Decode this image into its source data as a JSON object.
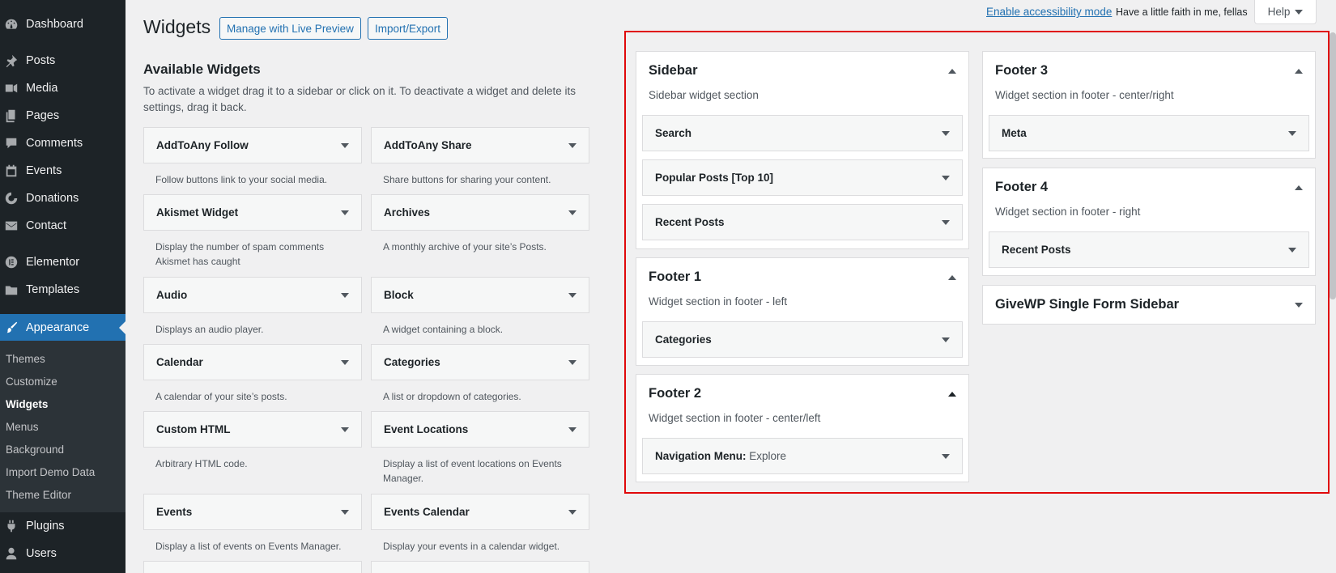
{
  "menu": {
    "dashboard": "Dashboard",
    "posts": "Posts",
    "media": "Media",
    "pages": "Pages",
    "comments": "Comments",
    "events": "Events",
    "donations": "Donations",
    "contact": "Contact",
    "elementor": "Elementor",
    "templates": "Templates",
    "appearance": "Appearance",
    "plugins": "Plugins",
    "users": "Users"
  },
  "submenu": {
    "themes": "Themes",
    "customize": "Customize",
    "widgets": "Widgets",
    "menus": "Menus",
    "background": "Background",
    "import_demo": "Import Demo Data",
    "theme_editor": "Theme Editor"
  },
  "header": {
    "title": "Widgets",
    "live_preview": "Manage with Live Preview",
    "import_export": "Import/Export",
    "accessibility": "Enable accessibility mode",
    "faith": "Have a little faith in me, fellas",
    "help": "Help"
  },
  "available": {
    "title": "Available Widgets",
    "description": "To activate a widget drag it to a sidebar or click on it. To deactivate a widget and delete its settings, drag it back.",
    "widgets": [
      {
        "title": "AddToAny Follow",
        "desc": "Follow buttons link to your social media."
      },
      {
        "title": "AddToAny Share",
        "desc": "Share buttons for sharing your content."
      },
      {
        "title": "Akismet Widget",
        "desc": "Display the number of spam comments Akismet has caught"
      },
      {
        "title": "Archives",
        "desc": "A monthly archive of your site’s Posts."
      },
      {
        "title": "Audio",
        "desc": "Displays an audio player."
      },
      {
        "title": "Block",
        "desc": "A widget containing a block."
      },
      {
        "title": "Calendar",
        "desc": "A calendar of your site’s posts."
      },
      {
        "title": "Categories",
        "desc": "A list or dropdown of categories."
      },
      {
        "title": "Custom HTML",
        "desc": "Arbitrary HTML code."
      },
      {
        "title": "Event Locations",
        "desc": "Display a list of event locations on Events Manager."
      },
      {
        "title": "Events",
        "desc": "Display a list of events on Events Manager."
      },
      {
        "title": "Events Calendar",
        "desc": "Display your events in a calendar widget."
      }
    ]
  },
  "areas": {
    "sidebar": {
      "title": "Sidebar",
      "desc": "Sidebar widget section",
      "widgets": [
        "Search",
        "Popular Posts [Top 10]",
        "Recent Posts"
      ]
    },
    "footer1": {
      "title": "Footer 1",
      "desc": "Widget section in footer - left",
      "widgets": [
        "Categories"
      ]
    },
    "footer2": {
      "title": "Footer 2",
      "desc": "Widget section in footer - center/left",
      "widget_title": "Navigation Menu:",
      "widget_sub": "Explore"
    },
    "footer3": {
      "title": "Footer 3",
      "desc": "Widget section in footer - center/right",
      "widgets": [
        "Meta"
      ]
    },
    "footer4": {
      "title": "Footer 4",
      "desc": "Widget section in footer - right",
      "widgets": [
        "Recent Posts"
      ]
    },
    "givewp": {
      "title": "GiveWP Single Form Sidebar"
    }
  },
  "colors": {
    "accent": "#2271b1",
    "highlight": "#e0090b",
    "menu_bg": "#1d2327"
  }
}
